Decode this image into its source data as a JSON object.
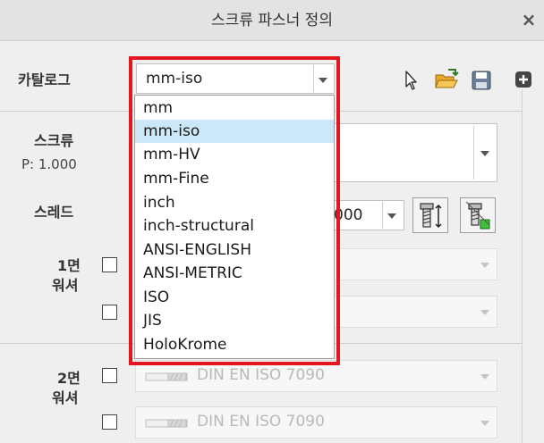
{
  "window": {
    "title": "스크류 파스너 정의",
    "close_glyph": "×"
  },
  "catalog": {
    "label": "카탈로그",
    "value": "mm-iso"
  },
  "toolbar": {
    "icons": [
      "cursor-icon",
      "open-folder-icon",
      "save-icon",
      "add-icon"
    ]
  },
  "screw": {
    "label": "스크류",
    "pitch": "P: 1.000"
  },
  "thread": {
    "label": "스레드",
    "value_partial": "000"
  },
  "washer1": {
    "label_line1": "1면",
    "label_line2": "워셔"
  },
  "washer2": {
    "label_line1": "2면",
    "label_line2": "워셔",
    "rows": [
      {
        "value": "DIN EN ISO 7090"
      },
      {
        "value": "DIN EN ISO 7090"
      }
    ]
  },
  "dropdown": {
    "selected": "mm-iso",
    "options": [
      "mm",
      "mm-iso",
      "mm-HV",
      "mm-Fine",
      "inch",
      "inch-structural",
      "ANSI-ENGLISH",
      "ANSI-METRIC",
      "ISO",
      "JIS",
      "HoloKrome"
    ]
  },
  "colors": {
    "highlight_border": "#e3171f",
    "selected_item": "#cce8f8"
  }
}
